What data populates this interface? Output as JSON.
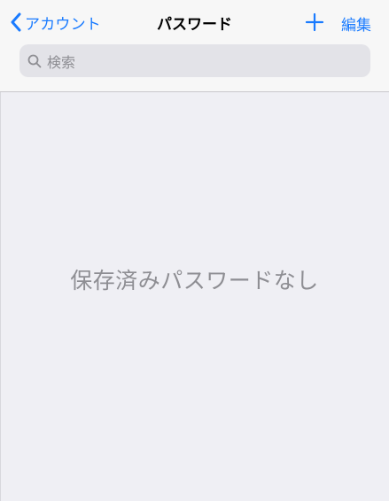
{
  "nav": {
    "back_label": "アカウント",
    "title": "パスワード",
    "edit_label": "編集"
  },
  "search": {
    "placeholder": "検索"
  },
  "main": {
    "empty_message": "保存済みパスワードなし"
  },
  "icons": {
    "back": "chevron-left-icon",
    "add": "plus-icon",
    "search": "magnifier-icon"
  },
  "colors": {
    "accent": "#1a7bff",
    "background": "#efeff4",
    "navbar": "#f7f7f7",
    "secondary_text": "#8e8e93"
  }
}
